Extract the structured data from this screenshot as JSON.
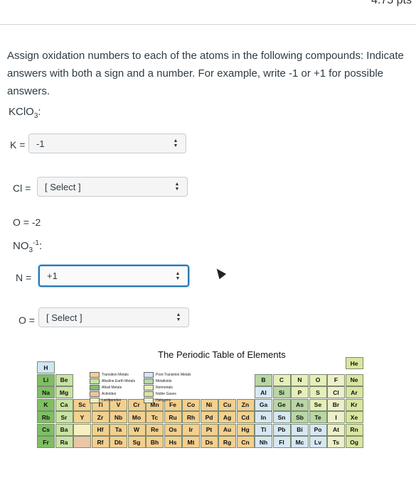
{
  "header": {
    "points": "4.75 pts"
  },
  "question": {
    "instructions": "Assign oxidation numbers to each of the atoms in the following compounds: Indicate answers with both a sign and a number. For example, write -1 or +1 for possible answers."
  },
  "compound1": {
    "name": "KClO",
    "subscript": "3",
    "colon": ":",
    "k_label": "K =",
    "k_value": "-1",
    "cl_label": "Cl =",
    "cl_value": "[ Select ]",
    "o_label": "O = -2"
  },
  "compound2": {
    "name": "NO",
    "subscript": "3",
    "superscript": "-1",
    "colon": ":",
    "n_label": "N =",
    "n_value": "+1",
    "o_label": "O =",
    "o_value": "[ Select ]"
  },
  "periodic_table": {
    "title": "The Periodic Table of Elements",
    "legend": [
      "Transition Metals",
      "Alkaline Earth Metals",
      "Alkali Metals",
      "Actinides",
      "Lanthanides",
      "Post-Transition Metals",
      "Metalloids",
      "Nonmetals",
      "Noble Gases",
      "Halogens"
    ],
    "elements": [
      {
        "s": "H",
        "c": "c-h"
      },
      {
        "s": "He",
        "c": "c-ng"
      },
      {
        "s": "Li",
        "c": "c-alk"
      },
      {
        "s": "Be",
        "c": "c-alke"
      },
      {
        "s": "B",
        "c": "c-met"
      },
      {
        "s": "C",
        "c": "c-non"
      },
      {
        "s": "N",
        "c": "c-non"
      },
      {
        "s": "O",
        "c": "c-non"
      },
      {
        "s": "F",
        "c": "c-hal"
      },
      {
        "s": "Ne",
        "c": "c-ng"
      },
      {
        "s": "Na",
        "c": "c-alk"
      },
      {
        "s": "Mg",
        "c": "c-alke"
      },
      {
        "s": "Al",
        "c": "c-ptm"
      },
      {
        "s": "Si",
        "c": "c-met"
      },
      {
        "s": "P",
        "c": "c-non"
      },
      {
        "s": "S",
        "c": "c-non"
      },
      {
        "s": "Cl",
        "c": "c-hal"
      },
      {
        "s": "Ar",
        "c": "c-ng"
      },
      {
        "s": "K",
        "c": "c-alk"
      },
      {
        "s": "Ca",
        "c": "c-alke"
      },
      {
        "s": "Sc",
        "c": "c-tm"
      },
      {
        "s": "Ti",
        "c": "c-tm"
      },
      {
        "s": "V",
        "c": "c-tm"
      },
      {
        "s": "Cr",
        "c": "c-tm"
      },
      {
        "s": "Mn",
        "c": "c-tm"
      },
      {
        "s": "Fe",
        "c": "c-tm"
      },
      {
        "s": "Co",
        "c": "c-tm"
      },
      {
        "s": "Ni",
        "c": "c-tm"
      },
      {
        "s": "Cu",
        "c": "c-tm"
      },
      {
        "s": "Zn",
        "c": "c-tm"
      },
      {
        "s": "Ga",
        "c": "c-ptm"
      },
      {
        "s": "Ge",
        "c": "c-met"
      },
      {
        "s": "As",
        "c": "c-met"
      },
      {
        "s": "Se",
        "c": "c-non"
      },
      {
        "s": "Br",
        "c": "c-hal"
      },
      {
        "s": "Kr",
        "c": "c-ng"
      },
      {
        "s": "Rb",
        "c": "c-alk"
      },
      {
        "s": "Sr",
        "c": "c-alke"
      },
      {
        "s": "Y",
        "c": "c-tm"
      },
      {
        "s": "Zr",
        "c": "c-tm"
      },
      {
        "s": "Nb",
        "c": "c-tm"
      },
      {
        "s": "Mo",
        "c": "c-tm"
      },
      {
        "s": "Tc",
        "c": "c-tm"
      },
      {
        "s": "Ru",
        "c": "c-tm"
      },
      {
        "s": "Rh",
        "c": "c-tm"
      },
      {
        "s": "Pd",
        "c": "c-tm"
      },
      {
        "s": "Ag",
        "c": "c-tm"
      },
      {
        "s": "Cd",
        "c": "c-tm"
      },
      {
        "s": "In",
        "c": "c-ptm"
      },
      {
        "s": "Sn",
        "c": "c-ptm"
      },
      {
        "s": "Sb",
        "c": "c-met"
      },
      {
        "s": "Te",
        "c": "c-met"
      },
      {
        "s": "I",
        "c": "c-hal"
      },
      {
        "s": "Xe",
        "c": "c-ng"
      },
      {
        "s": "Cs",
        "c": "c-alk"
      },
      {
        "s": "Ba",
        "c": "c-alke"
      },
      {
        "s": "",
        "c": "c-lan"
      },
      {
        "s": "Hf",
        "c": "c-tm"
      },
      {
        "s": "Ta",
        "c": "c-tm"
      },
      {
        "s": "W",
        "c": "c-tm"
      },
      {
        "s": "Re",
        "c": "c-tm"
      },
      {
        "s": "Os",
        "c": "c-tm"
      },
      {
        "s": "Ir",
        "c": "c-tm"
      },
      {
        "s": "Pt",
        "c": "c-tm"
      },
      {
        "s": "Au",
        "c": "c-tm"
      },
      {
        "s": "Hg",
        "c": "c-tm"
      },
      {
        "s": "Tl",
        "c": "c-ptm"
      },
      {
        "s": "Pb",
        "c": "c-ptm"
      },
      {
        "s": "Bi",
        "c": "c-ptm"
      },
      {
        "s": "Po",
        "c": "c-ptm"
      },
      {
        "s": "At",
        "c": "c-hal"
      },
      {
        "s": "Rn",
        "c": "c-ng"
      },
      {
        "s": "Fr",
        "c": "c-alk"
      },
      {
        "s": "Ra",
        "c": "c-alke"
      },
      {
        "s": "",
        "c": "c-act"
      },
      {
        "s": "Rf",
        "c": "c-tm"
      },
      {
        "s": "Db",
        "c": "c-tm"
      },
      {
        "s": "Sg",
        "c": "c-tm"
      },
      {
        "s": "Bh",
        "c": "c-tm"
      },
      {
        "s": "Hs",
        "c": "c-tm"
      },
      {
        "s": "Mt",
        "c": "c-tm"
      },
      {
        "s": "Ds",
        "c": "c-tm"
      },
      {
        "s": "Rg",
        "c": "c-tm"
      },
      {
        "s": "Cn",
        "c": "c-tm"
      },
      {
        "s": "Nh",
        "c": "c-ptm"
      },
      {
        "s": "Fl",
        "c": "c-ptm"
      },
      {
        "s": "Mc",
        "c": "c-ptm"
      },
      {
        "s": "Lv",
        "c": "c-ptm"
      },
      {
        "s": "Ts",
        "c": "c-hal"
      },
      {
        "s": "Og",
        "c": "c-ng"
      }
    ]
  }
}
